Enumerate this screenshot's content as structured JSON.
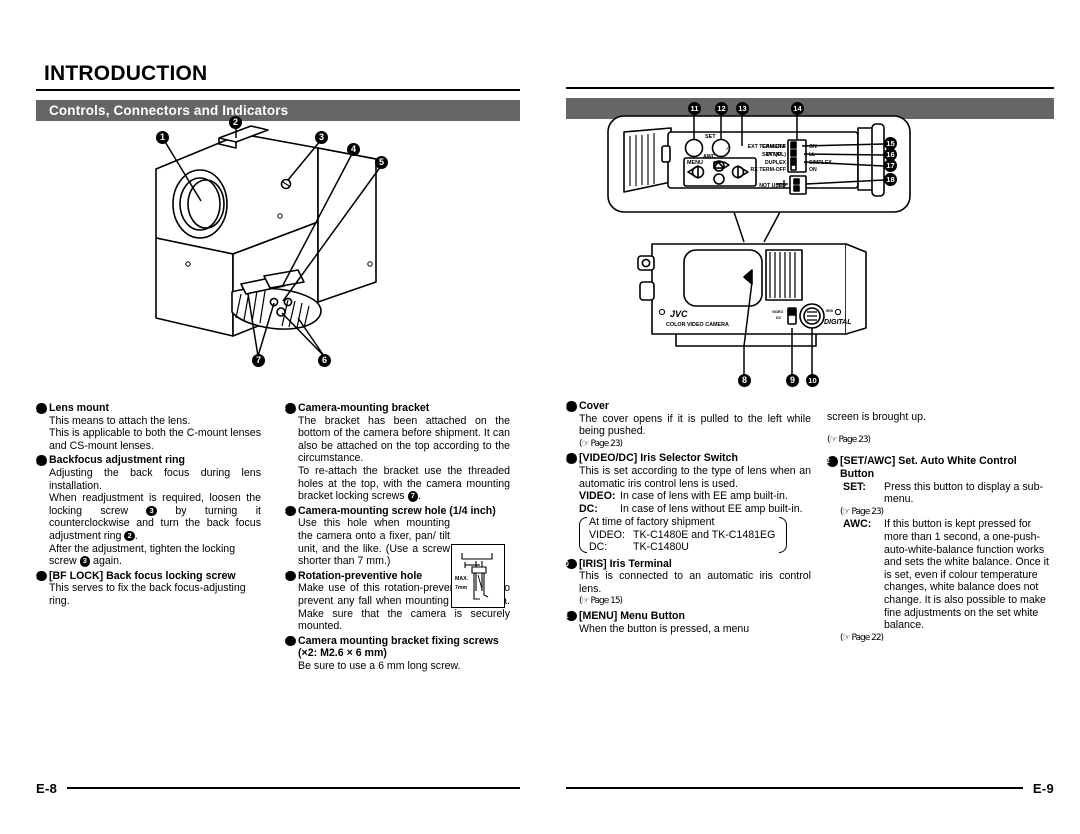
{
  "left_page": {
    "chapter_title": "INTRODUCTION",
    "section_bar": "Controls, Connectors and Indicators",
    "page_number": "E-8",
    "figure": {
      "callouts": [
        "1",
        "2",
        "3",
        "4",
        "5",
        "6",
        "7"
      ],
      "inset_labels": [
        "MAX.",
        "7mm"
      ]
    },
    "col1": [
      {
        "num": "1",
        "title": "Lens mount",
        "paras": [
          "This means to attach the lens.",
          "This is applicable to both the C-mount lenses and CS-mount lenses."
        ]
      },
      {
        "num": "2",
        "title": "Backfocus adjustment ring",
        "paras": [
          "Adjusting the back focus during lens installation."
        ],
        "rich": [
          "When readjustment is required, loosen the locking screw ❸ by turning it counterclockwise and turn the back focus adjustment ring ❷.",
          "After the adjustment, tighten the locking screw ❸ again."
        ]
      },
      {
        "num": "3",
        "title": "[BF LOCK] Back focus locking screw",
        "paras": [
          "This serves to fix the back focus-adjusting ring."
        ]
      }
    ],
    "col2": [
      {
        "num": "4",
        "title": "Camera-mounting bracket",
        "paras": [
          "The bracket has been attached on the bottom of the camera before shipment. It can also be attached on the top according to the circumstance.",
          "To re-attach the bracket use the threaded holes at the top, with the camera mounting bracket locking screws ❼."
        ]
      },
      {
        "num": "5",
        "title": "Camera-mounting screw hole (1/4 inch)",
        "paras": [
          "Use this hole when mounting the camera onto a fixer, pan/ tilt unit, and the like. (Use a screw shorter than 7 mm.)"
        ]
      },
      {
        "num": "6",
        "title": "Rotation-preventive hole",
        "paras": [
          "Make use of this rotation-preventive hole to prevent any fall when mounting the camera.  Make sure that the camera is securely mounted."
        ]
      },
      {
        "num": "7",
        "title": "Camera mounting bracket fixing screws (×2: M2.6 × 6 mm)",
        "paras": [
          "Be sure to use a 6 mm long screw."
        ]
      }
    ]
  },
  "right_page": {
    "section_bar": "",
    "page_number": "E-9",
    "figure": {
      "callouts": [
        "11",
        "12",
        "13",
        "14",
        "15",
        "16",
        "17",
        "18",
        "8",
        "9",
        "10"
      ],
      "panel_labels": [
        "SET",
        "AWC",
        "CAMERA",
        "SET UP",
        "MENU",
        "EXT TERM-OFF",
        "ON",
        "INT(GL)",
        "LL",
        "DUPLEX",
        "SIMPLEX",
        "RX TERM-OFF",
        "ON",
        "NOT USED"
      ],
      "body_labels": [
        "JVC",
        "COLOR VIDEO CAMERA",
        "DIGITAL",
        "VIDEO",
        "DC",
        "IRIS"
      ]
    },
    "col1": [
      {
        "num": "8",
        "title": "Cover",
        "paras": [
          "The cover opens if it is pulled to the left while being pushed.",
          "(☞ Page 23)"
        ]
      },
      {
        "num": "9",
        "title": "[VIDEO/DC] Iris Selector Switch",
        "paras": [
          "This is set according to the type of lens when an automatic iris control lens is used."
        ],
        "defs": [
          {
            "k": "VIDEO:",
            "v": "In case of lens with EE amp built-in."
          },
          {
            "k": "DC:",
            "v": "In case of lens without EE amp built-in."
          }
        ],
        "bracket": [
          {
            "k": "",
            "v": "At time of factory shipment"
          },
          {
            "k": "VIDEO:",
            "v": "TK-C1480E and TK-C1481EG"
          },
          {
            "k": "DC:",
            "v": "TK-C1480U"
          }
        ]
      },
      {
        "num": "10",
        "title": "[IRIS] Iris Terminal",
        "paras": [
          "This is connected to an automatic iris control lens.",
          "(☞ Page 15)"
        ]
      },
      {
        "num": "11",
        "title": "[MENU] Menu Button",
        "paras": [
          "When the button is pressed, a menu"
        ]
      }
    ],
    "col2": {
      "continuation": [
        "screen is brought up.",
        "(☞ Page 23)"
      ],
      "entry": {
        "num": "12",
        "title": "[SET/AWC] Set. Auto White Control Button",
        "defs": [
          {
            "k": "SET:",
            "v": "Press this button to display a sub-menu.",
            "ref": "(☞ Page 23)"
          },
          {
            "k": "AWC:",
            "v": "If this button is kept pressed for more than 1 second, a one-push-auto-white-balance function works and sets the white balance.  Once it is set, even if colour temperature changes, white balance does not change. It is also possible to make fine adjustments on the set white balance.",
            "ref": "(☞ Page 22)"
          }
        ]
      }
    }
  },
  "colors": {
    "section_bar_bg": "#666666",
    "text": "#000000",
    "page_bg": "#ffffff"
  }
}
